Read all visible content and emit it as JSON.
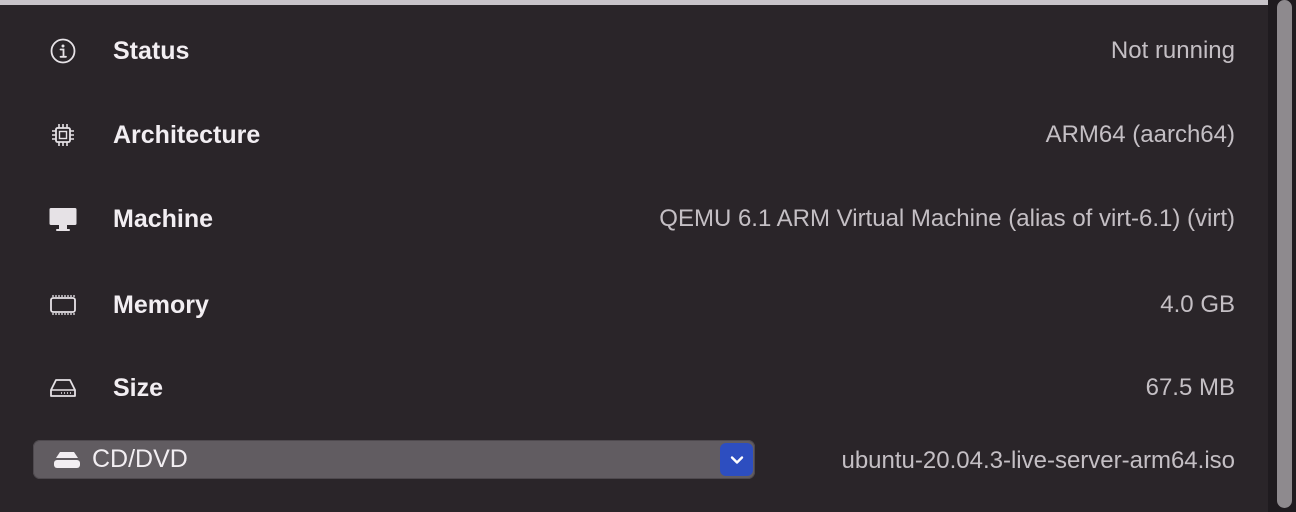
{
  "rows": [
    {
      "label": "Status",
      "value": "Not running",
      "icon": "info-icon"
    },
    {
      "label": "Architecture",
      "value": "ARM64 (aarch64)",
      "icon": "cpu-chip-icon"
    },
    {
      "label": "Machine",
      "value": "QEMU 6.1 ARM Virtual Machine (alias of virt-6.1) (virt)",
      "icon": "display-icon"
    },
    {
      "label": "Memory",
      "value": "4.0 GB",
      "icon": "memory-icon"
    },
    {
      "label": "Size",
      "value": "67.5 MB",
      "icon": "drive-icon"
    }
  ],
  "drive": {
    "type_label": "CD/DVD",
    "image_name": "ubuntu-20.04.3-live-server-arm64.iso"
  },
  "colors": {
    "background": "#2a2529",
    "select_accent": "#2d4ec0"
  }
}
